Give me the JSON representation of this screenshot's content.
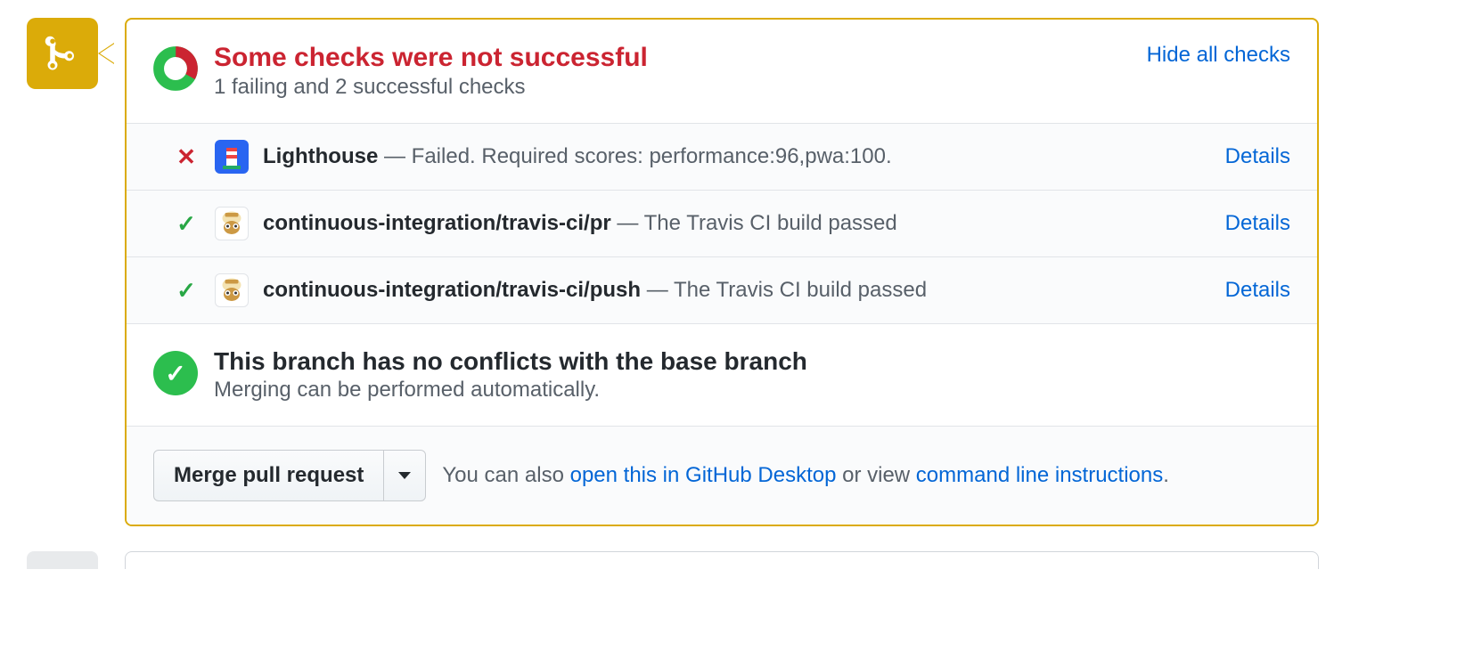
{
  "header": {
    "title": "Some checks were not successful",
    "subtitle": "1 failing and 2 successful checks",
    "hide_link": "Hide all checks"
  },
  "checks": [
    {
      "status": "fail",
      "avatar": "lighthouse",
      "name": "Lighthouse",
      "sep": " — ",
      "message": "Failed. Required scores: performance:96,pwa:100.",
      "details": "Details"
    },
    {
      "status": "pass",
      "avatar": "travis",
      "name": "continuous-integration/travis-ci/pr",
      "sep": " — ",
      "message": "The Travis CI build passed",
      "details": "Details"
    },
    {
      "status": "pass",
      "avatar": "travis",
      "name": "continuous-integration/travis-ci/push",
      "sep": " — ",
      "message": "The Travis CI build passed",
      "details": "Details"
    }
  ],
  "conflict": {
    "title": "This branch has no conflicts with the base branch",
    "subtitle": "Merging can be performed automatically."
  },
  "merge": {
    "button": "Merge pull request",
    "text_prefix": "You can also ",
    "link_desktop": "open this in GitHub Desktop",
    "text_mid": " or view ",
    "link_cli": "command line instructions",
    "text_suffix": "."
  }
}
